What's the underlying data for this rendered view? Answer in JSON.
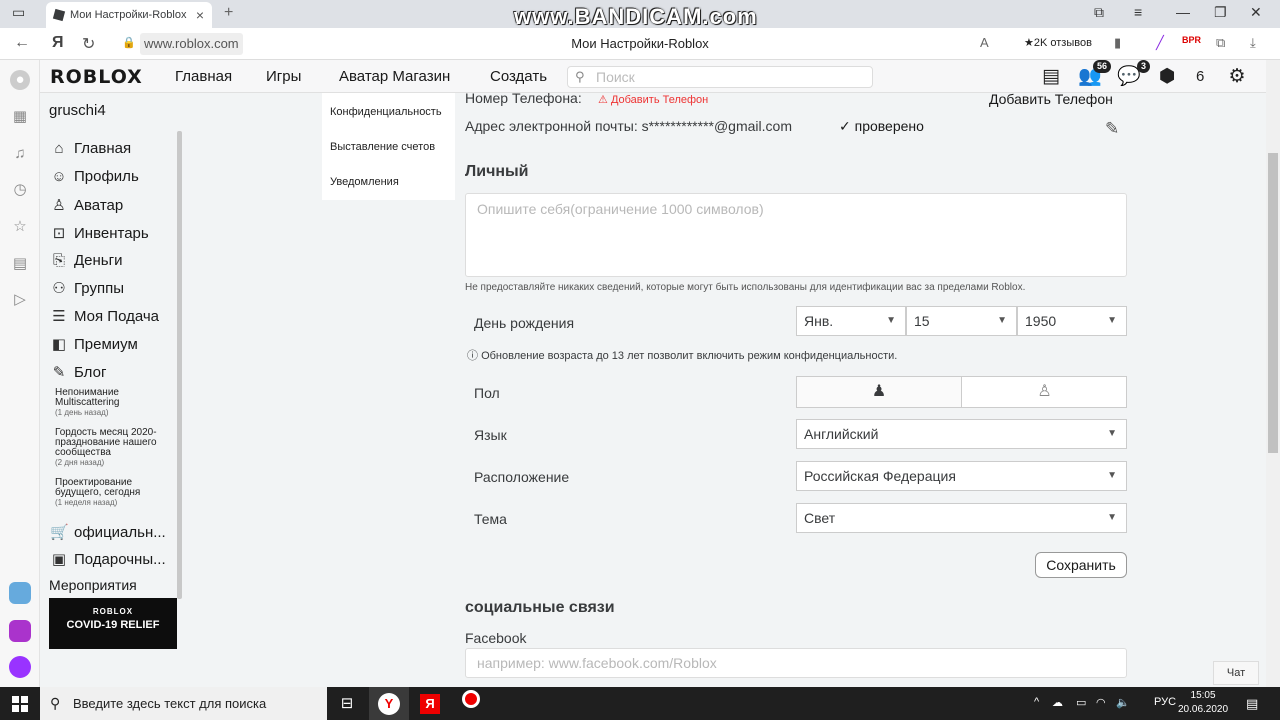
{
  "browser": {
    "tab_title": "Мои Настройки-Roblox",
    "url": "www.roblox.com",
    "page_title": "Мои Настройки-Roblox",
    "reviews": "★2K отзывов",
    "watermark": "www.BANDICAM.com",
    "yandex_letter": "Я"
  },
  "rbx_nav": {
    "logo": "ROBLOX",
    "links": [
      "Главная",
      "Игры",
      "Аватар Магазин",
      "Создать"
    ],
    "search_placeholder": "Поиск",
    "friends_badge": "56",
    "messages_badge": "3",
    "robux": "6"
  },
  "left_nav": {
    "username": "gruschi4",
    "items": [
      "Главная",
      "Профиль",
      "Аватар",
      "Инвентарь",
      "Деньги",
      "Группы",
      "Моя Подача",
      "Премиум",
      "Блог"
    ],
    "blog_posts": [
      {
        "title": "Непонимание Multiscattering",
        "date": "(1 день назад)"
      },
      {
        "title": "Гордость месяц 2020-празднование нашего сообщества",
        "date": "(2 дня назад)"
      },
      {
        "title": "Проектирование будущего, сегодня",
        "date": "(1 неделя назад)"
      }
    ],
    "extra_items": [
      "официальн...",
      "Подарочны..."
    ],
    "events_label": "Мероприятия",
    "banner_brand": "ROBLOX",
    "banner_text": "COVID-19 RELIEF"
  },
  "settings_nav": [
    "Конфиденциальность",
    "Выставление счетов",
    "Уведомления"
  ],
  "account": {
    "phone_label": "Номер Телефона:",
    "phone_warning": "Добавить Телефон",
    "phone_button": "Добавить Телефон",
    "email_label": "Адрес электронной почты: s************@gmail.com",
    "email_verified": "проверено"
  },
  "personal": {
    "heading": "Личный",
    "about_placeholder": "Опишите себя(ограничение 1000 символов)",
    "hint": "Не предоставляйте никаких сведений, которые могут быть использованы для идентификации вас за пределами Roblox.",
    "birthday_label": "День рождения",
    "birth_month": "Янв.",
    "birth_day": "15",
    "birth_year": "1950",
    "age_notice": "Обновление возраста до 13 лет позволит включить режим конфиденциальности.",
    "gender_label": "Пол",
    "language_label": "Язык",
    "language_value": "Английский",
    "location_label": "Расположение",
    "location_value": "Российская Федерация",
    "theme_label": "Тема",
    "theme_value": "Свет",
    "save_button": "Сохранить"
  },
  "social": {
    "heading": "социальные связи",
    "facebook_label": "Facebook",
    "facebook_placeholder": "например: www.facebook.com/Roblox"
  },
  "chat_button": "Чат",
  "taskbar": {
    "search_placeholder": "Введите здесь текст для поиска",
    "lang": "РУС",
    "time": "15:05",
    "date": "20.06.2020"
  }
}
